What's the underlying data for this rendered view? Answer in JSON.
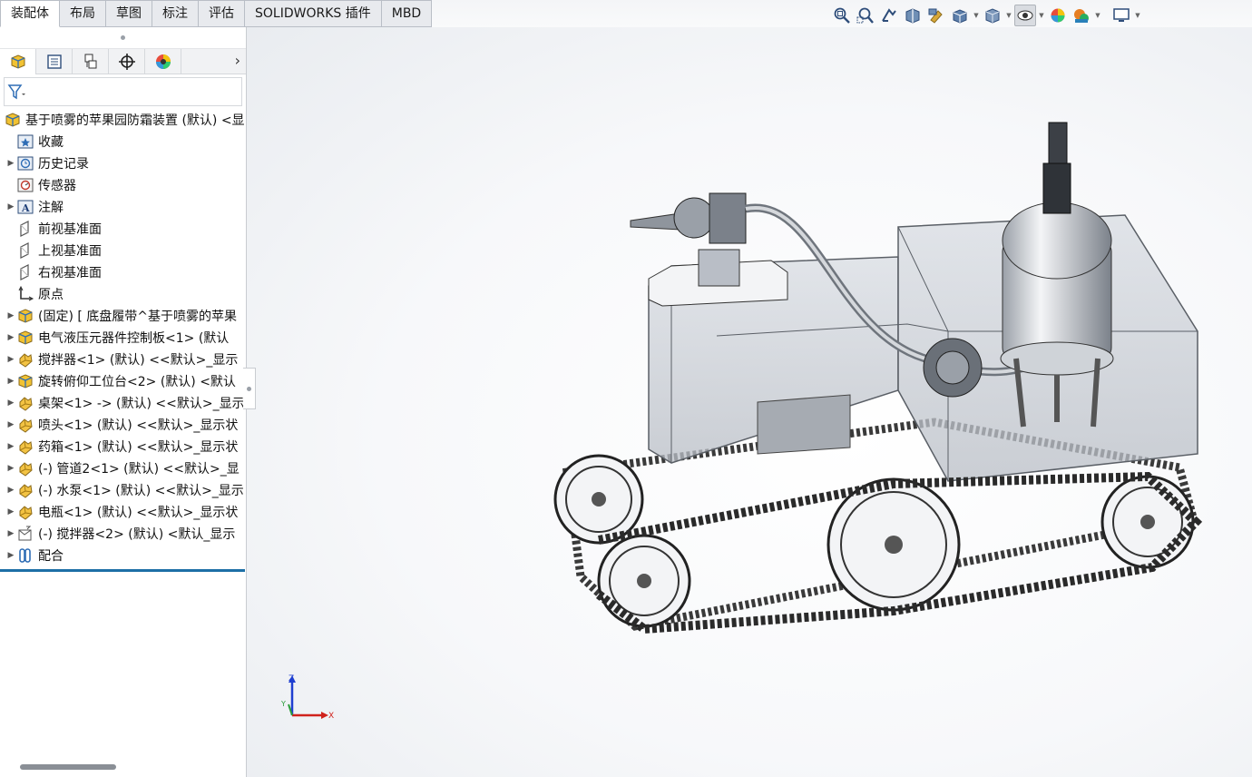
{
  "tabs": [
    {
      "label": "装配体",
      "active": true
    },
    {
      "label": "布局"
    },
    {
      "label": "草图"
    },
    {
      "label": "标注"
    },
    {
      "label": "评估"
    },
    {
      "label": "SOLIDWORKS 插件"
    },
    {
      "label": "MBD"
    }
  ],
  "feature_manager": {
    "panel_tabs": [
      "featuremanager-icon",
      "propertymanager-icon",
      "configurationmanager-icon",
      "dimxpert-icon",
      "display-manager-icon"
    ],
    "more_glyph": "›",
    "root": "基于喷雾的苹果园防霜装置 (默认) <显",
    "items": [
      {
        "label": "收藏",
        "icon": "favorites-icon",
        "expandable": false
      },
      {
        "label": "历史记录",
        "icon": "history-icon",
        "expandable": true
      },
      {
        "label": "传感器",
        "icon": "sensors-icon",
        "expandable": false
      },
      {
        "label": "注解",
        "icon": "annotations-icon",
        "expandable": true
      },
      {
        "label": "前视基准面",
        "icon": "plane-icon",
        "expandable": false
      },
      {
        "label": "上视基准面",
        "icon": "plane-icon",
        "expandable": false
      },
      {
        "label": "右视基准面",
        "icon": "plane-icon",
        "expandable": false
      },
      {
        "label": "原点",
        "icon": "origin-icon",
        "expandable": false
      },
      {
        "label": "(固定) [ 底盘履带^基于喷雾的苹果",
        "icon": "subassembly-icon",
        "expandable": true
      },
      {
        "label": "电气液压元器件控制板<1> (默认",
        "icon": "subassembly-icon",
        "expandable": true
      },
      {
        "label": "搅拌器<1> (默认) <<默认>_显示",
        "icon": "part-icon",
        "expandable": true
      },
      {
        "label": "旋转俯仰工位台<2> (默认) <默认",
        "icon": "subassembly-icon",
        "expandable": true
      },
      {
        "label": "桌架<1> -> (默认) <<默认>_显示",
        "icon": "part-icon",
        "expandable": true
      },
      {
        "label": "喷头<1> (默认) <<默认>_显示状",
        "icon": "part-icon",
        "expandable": true
      },
      {
        "label": "药箱<1> (默认) <<默认>_显示状",
        "icon": "part-icon",
        "expandable": true
      },
      {
        "label": "(-) 管道2<1> (默认) <<默认>_显",
        "icon": "part-icon",
        "expandable": true
      },
      {
        "label": "(-) 水泵<1> (默认) <<默认>_显示",
        "icon": "part-icon",
        "expandable": true
      },
      {
        "label": "电瓶<1> (默认) <<默认>_显示状",
        "icon": "part-icon",
        "expandable": true
      },
      {
        "label": "(-) 搅拌器<2> (默认) <默认_显示",
        "icon": "part-edit-icon",
        "expandable": true
      },
      {
        "label": "配合",
        "icon": "mates-icon",
        "expandable": true
      }
    ]
  },
  "heads_up_toolbar": [
    "zoom-to-fit-icon",
    "zoom-to-area-icon",
    "previous-view-icon",
    "section-view-icon",
    "dynamic-annotation-icon",
    "view-orientation-icon",
    "display-style-icon",
    "hide-show-items-icon",
    "edit-appearance-icon",
    "apply-scene-icon",
    "view-settings-icon"
  ],
  "triad": {
    "z": "Z",
    "x": "X",
    "y": "Y"
  },
  "colors": {
    "accent": "#1d6fa6",
    "axis_x": "#d0221c",
    "axis_y": "#2a9d3a",
    "axis_z": "#1f3fd0"
  }
}
